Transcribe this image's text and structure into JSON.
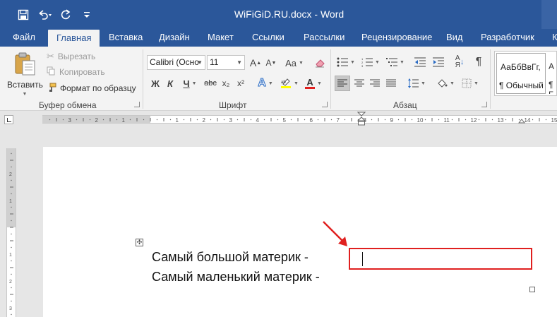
{
  "window": {
    "title": "WiFiGiD.RU.docx - Word"
  },
  "tabs": [
    {
      "label": "Файл"
    },
    {
      "label": "Главная"
    },
    {
      "label": "Вставка"
    },
    {
      "label": "Дизайн"
    },
    {
      "label": "Макет"
    },
    {
      "label": "Ссылки"
    },
    {
      "label": "Рассылки"
    },
    {
      "label": "Рецензирование"
    },
    {
      "label": "Вид"
    },
    {
      "label": "Разработчик"
    },
    {
      "label": "К"
    }
  ],
  "clipboard": {
    "paste_label": "Вставить",
    "cut_label": "Вырезать",
    "copy_label": "Копировать",
    "format_painter_label": "Формат по образцу",
    "group_label": "Буфер обмена"
  },
  "font": {
    "family": "Calibri (Осно",
    "size": "11",
    "group_label": "Шрифт",
    "bold": "Ж",
    "italic": "К",
    "underline": "Ч",
    "strike": "abc",
    "subscript": "x₂",
    "superscript": "x²",
    "grow": "A",
    "shrink": "A",
    "change_case": "Aa",
    "font_color": "A"
  },
  "paragraph": {
    "group_label": "Абзац",
    "pilcrow": "¶"
  },
  "styles": {
    "sample": "АаБбВвГг,",
    "normal_label": "¶ Обычный",
    "next_sample": "А",
    "next_label": "¶ Б"
  },
  "document": {
    "line1": "Самый большой материк -",
    "line2": "Самый маленький материк -",
    "move_handle": "✣"
  },
  "colors": {
    "accent": "#2b579a",
    "annotation": "#e0201f",
    "highlight": "#ffff00",
    "font_color_bar": "#e0201f"
  }
}
